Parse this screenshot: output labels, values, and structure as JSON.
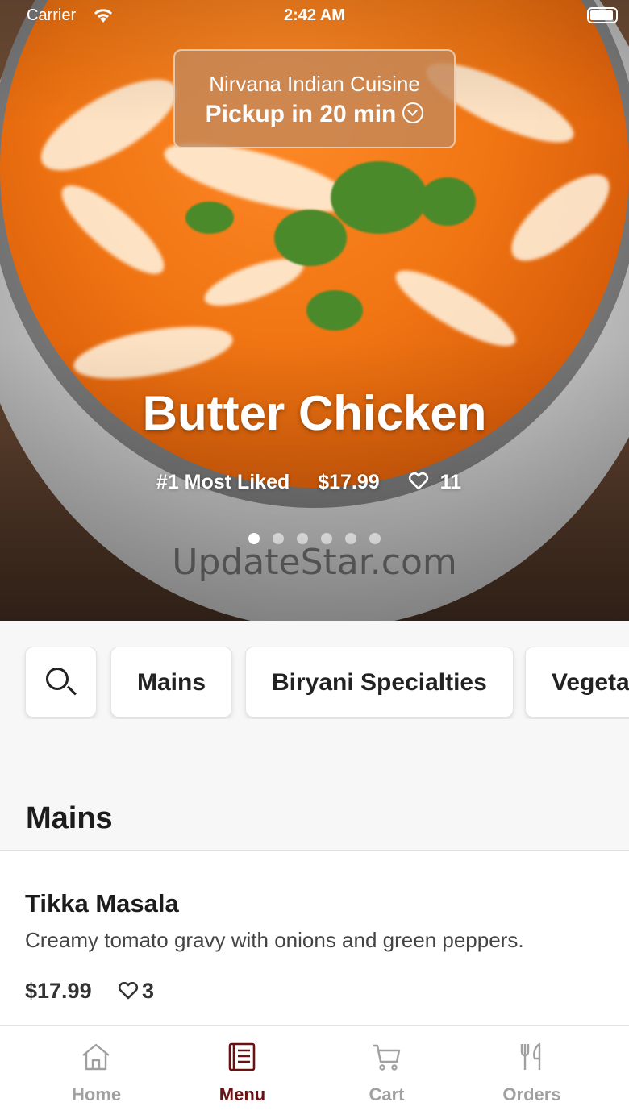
{
  "status_bar": {
    "carrier": "Carrier",
    "time": "2:42 AM"
  },
  "header": {
    "restaurant_name": "Nirvana Indian Cuisine",
    "pickup_text": "Pickup in 20 min"
  },
  "featured": {
    "title": "Butter Chicken",
    "badge": "#1 Most Liked",
    "price": "$17.99",
    "likes": "11",
    "carousel_pages": 6,
    "carousel_active_index": 0
  },
  "watermark": "UpdateStar.com",
  "categories": [
    "Mains",
    "Biryani Specialties",
    "Vegeta"
  ],
  "section": {
    "title": "Mains"
  },
  "items": [
    {
      "name": "Tikka Masala",
      "description": "Creamy tomato gravy with onions and green peppers.",
      "price": "$17.99",
      "likes": "3"
    }
  ],
  "tabs": [
    {
      "label": "Home",
      "icon": "home-icon",
      "active": false
    },
    {
      "label": "Menu",
      "icon": "menu-book-icon",
      "active": true
    },
    {
      "label": "Cart",
      "icon": "cart-icon",
      "active": false
    },
    {
      "label": "Orders",
      "icon": "fork-knife-icon",
      "active": false
    }
  ],
  "colors": {
    "accent": "#6b1111",
    "inactive_tab": "#a0a0a0",
    "pickup_bg": "#c48858"
  }
}
